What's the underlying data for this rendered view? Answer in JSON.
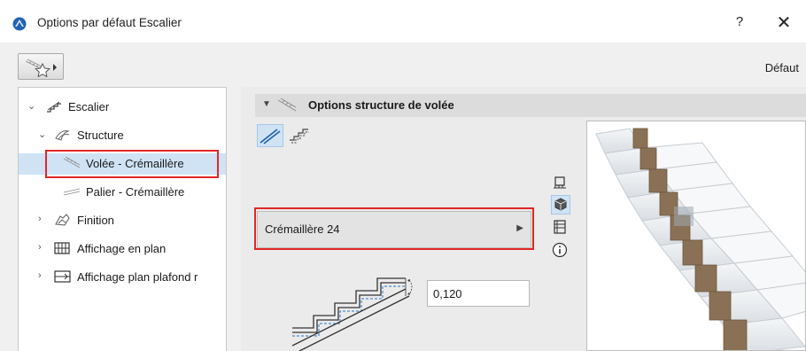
{
  "window": {
    "title": "Options par défaut Escalier",
    "help_label": "?",
    "close_label": "✕",
    "app_icon": "archicad-logo-icon"
  },
  "toolbar": {
    "favorites_icon": "favorites-star-icon",
    "default_label": "Défaut"
  },
  "tree": {
    "items": [
      {
        "label": "Escalier",
        "expanded": true,
        "icon": "stair-icon"
      },
      {
        "label": "Structure",
        "expanded": true,
        "icon": "structure-icon"
      },
      {
        "label": "Volée - Crémaillère",
        "selected": true,
        "highlighted": true,
        "icon": "flight-stringer-icon"
      },
      {
        "label": "Palier - Crémaillère",
        "icon": "landing-stringer-icon"
      },
      {
        "label": "Finition",
        "expanded": false,
        "icon": "finish-icon"
      },
      {
        "label": "Affichage en plan",
        "expanded": false,
        "icon": "floor-plan-display-icon"
      },
      {
        "label": "Affichage plan plafond r",
        "expanded": false,
        "icon": "ceiling-plan-icon"
      }
    ]
  },
  "section": {
    "title": "Options structure de volée",
    "icon": "flight-structure-icon"
  },
  "structure_modes": [
    {
      "name": "inclined-stringer-icon",
      "active": true
    },
    {
      "name": "stepped-stringer-icon",
      "active": false
    }
  ],
  "profile": {
    "value": "Crémaillère 24",
    "highlighted": true
  },
  "dimension": {
    "value": "0,120"
  },
  "view_icons": [
    {
      "name": "floor-plan-view-icon",
      "active": false
    },
    {
      "name": "3d-view-icon",
      "active": true
    },
    {
      "name": "section-view-icon",
      "active": false
    },
    {
      "name": "info-icon",
      "active": false
    }
  ],
  "colors": {
    "highlight": "#e32626",
    "selection": "#cfe3f5",
    "stringer": "#8a7155"
  }
}
